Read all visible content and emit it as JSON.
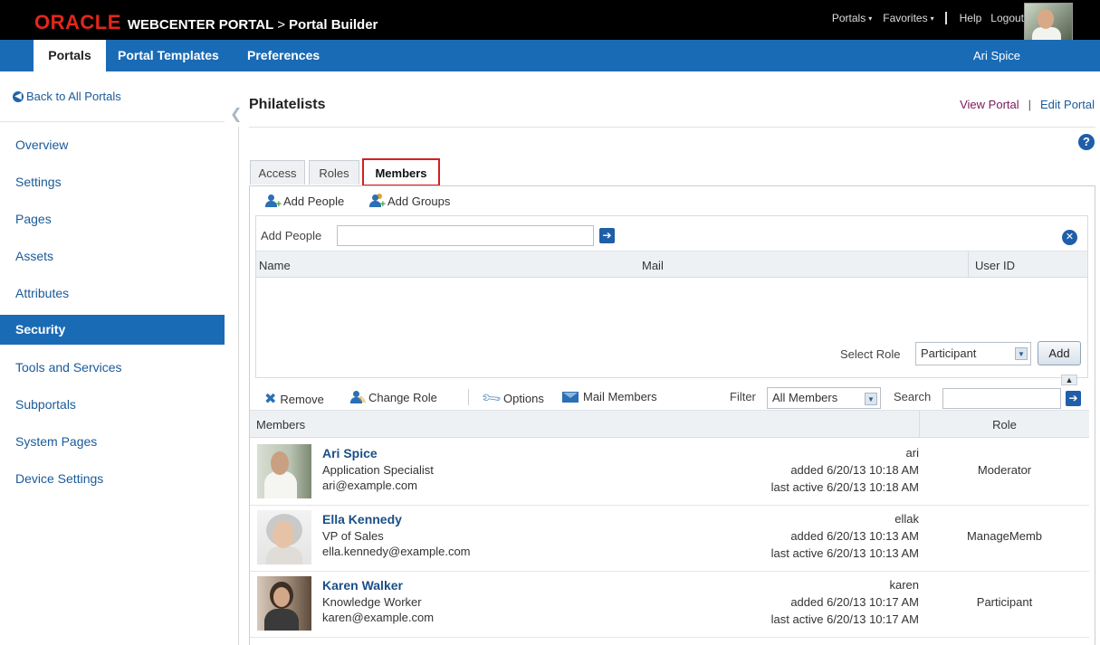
{
  "header": {
    "brand_oracle": "ORACLE",
    "brand_product": "WEBCENTER PORTAL",
    "brand_sep": ">",
    "brand_app": "Portal Builder",
    "nav_portals": "Portals",
    "nav_favorites": "Favorites",
    "nav_help": "Help",
    "nav_logout": "Logout",
    "caret": "▾"
  },
  "tabs": {
    "portals": "Portals",
    "portal_templates": "Portal Templates",
    "preferences": "Preferences",
    "username": "Ari Spice"
  },
  "sidebar": {
    "back": "Back to All Portals",
    "items": [
      {
        "label": "Overview"
      },
      {
        "label": "Settings"
      },
      {
        "label": "Pages"
      },
      {
        "label": "Assets"
      },
      {
        "label": "Attributes"
      },
      {
        "label": "Security"
      },
      {
        "label": "Tools and Services"
      },
      {
        "label": "Subportals"
      },
      {
        "label": "System Pages"
      },
      {
        "label": "Device Settings"
      }
    ]
  },
  "main": {
    "title": "Philatelists",
    "view_portal": "View Portal",
    "link_sep": "|",
    "edit_portal": "Edit Portal",
    "help": "?",
    "subtabs": {
      "access": "Access",
      "roles": "Roles",
      "members": "Members"
    }
  },
  "add_panel": {
    "add_people_btn": "Add People",
    "add_groups_btn": "Add Groups",
    "add_people_label": "Add People",
    "add_people_value": "",
    "columns": {
      "name": "Name",
      "mail": "Mail",
      "userid": "User ID"
    },
    "select_role_label": "Select Role",
    "role_value": "Participant",
    "add_button": "Add"
  },
  "members_toolbar": {
    "remove": "Remove",
    "change_role": "Change Role",
    "options": "Options",
    "mail_members": "Mail Members",
    "filter_label": "Filter",
    "filter_value": "All Members",
    "search_label": "Search",
    "search_value": ""
  },
  "members_table": {
    "col_members": "Members",
    "col_role": "Role",
    "rows": [
      {
        "name": "Ari Spice",
        "title": "Application Specialist",
        "email": "ari@example.com",
        "userid": "ari",
        "added": "added 6/20/13 10:18 AM",
        "last_active": "last active 6/20/13 10:18 AM",
        "role": "Moderator"
      },
      {
        "name": "Ella Kennedy",
        "title": "VP of Sales",
        "email": "ella.kennedy@example.com",
        "userid": "ellak",
        "added": "added 6/20/13 10:13 AM",
        "last_active": "last active 6/20/13 10:13 AM",
        "role": "ManageMemb"
      },
      {
        "name": "Karen Walker",
        "title": "Knowledge Worker",
        "email": "karen@example.com",
        "userid": "karen",
        "added": "added 6/20/13 10:17 AM",
        "last_active": "last active 6/20/13 10:17 AM",
        "role": "Participant"
      }
    ]
  },
  "colors": {
    "accent_blue": "#1a6bb5",
    "oracle_red": "#e3261d",
    "highlight_red": "#d42020"
  }
}
